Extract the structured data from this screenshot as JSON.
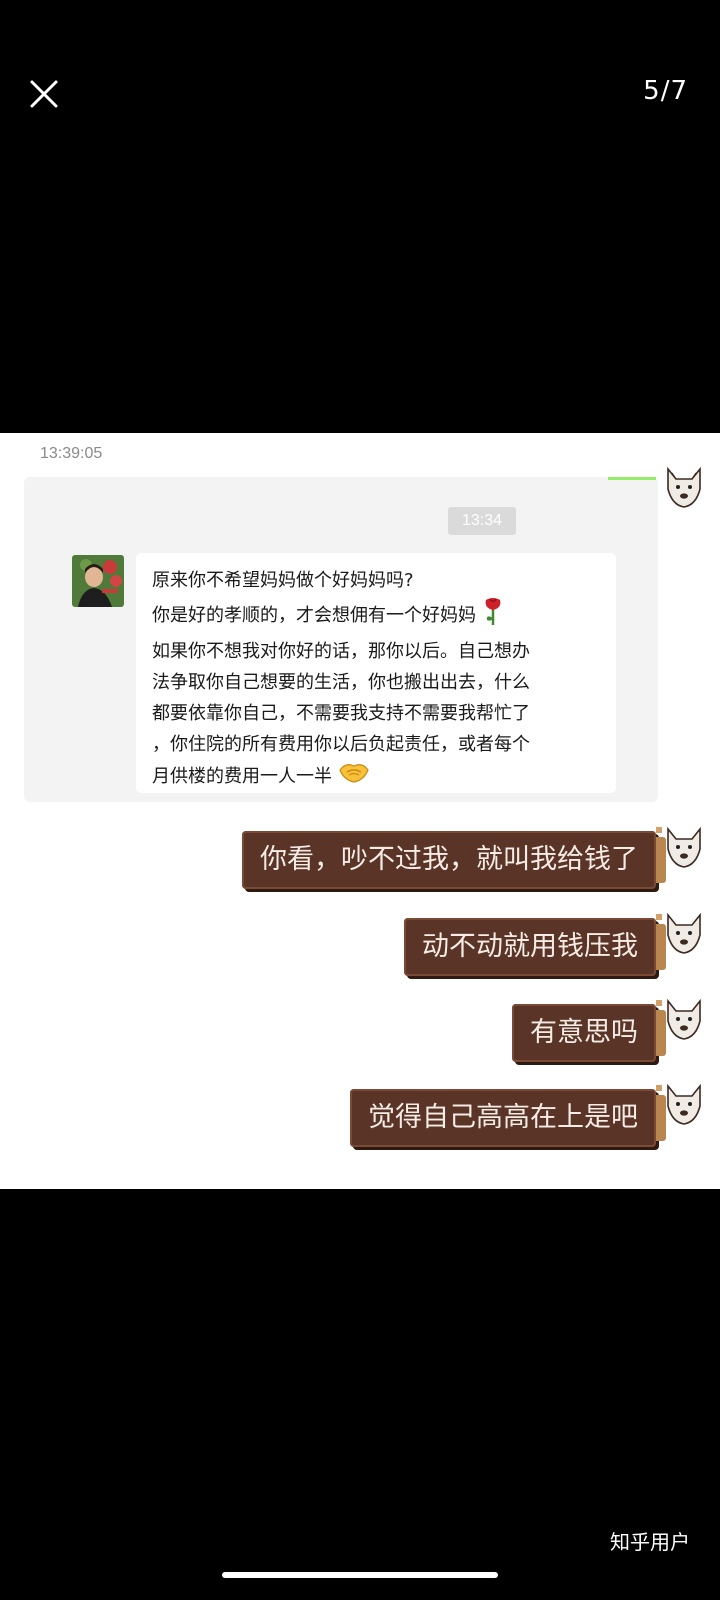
{
  "viewer": {
    "page_counter": "5/7",
    "close_icon": "close-icon"
  },
  "chat": {
    "top_timestamp": "13:39:05",
    "quoted": {
      "timestamp": "13:34",
      "lines": [
        "原来你不希望妈妈做个好妈妈吗?",
        "你是好的孝顺的，才会想佣有一个好妈妈",
        "如果你不想我对你好的话，那你以后。自己想办",
        "法争取你自己想要的生活，你也搬出出去，什么",
        "都要依靠你自己，不需要我支持不需要我帮忙了",
        "，你住院的所有费用你以后负起责任，或者每个",
        "月供楼的费用一人一半"
      ],
      "emoji_rose": "rose-emoji",
      "emoji_handshake": "handshake-emoji"
    },
    "messages": [
      "你看，吵不过我，就叫我给钱了",
      "动不动就用钱压我",
      "有意思吗",
      "觉得自己高高在上是吧"
    ]
  },
  "watermark": "知乎用户",
  "colors": {
    "bubble_self": "#5a3527",
    "bubble_frame": "#b9864f",
    "background": "#000000",
    "chat_background": "#ffffff"
  }
}
